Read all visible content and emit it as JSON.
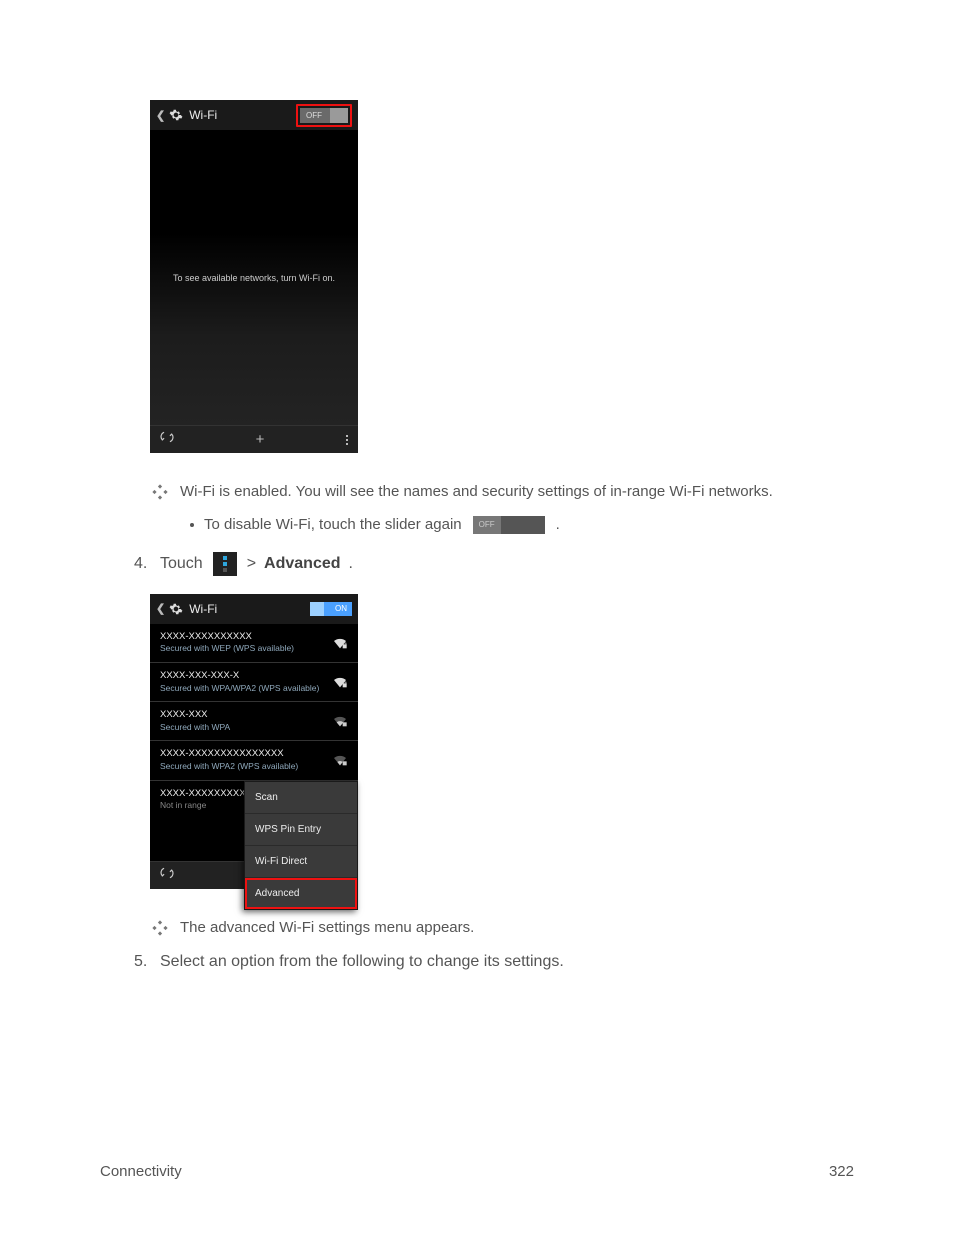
{
  "phone1": {
    "title": "Wi-Fi",
    "toggle": "OFF",
    "message": "To see available networks, turn Wi-Fi on."
  },
  "notes": {
    "enabled": "Wi-Fi is enabled. You will see the names and security settings of in-range Wi-Fi networks.",
    "disable_prefix": "To disable Wi-Fi, touch the slider again",
    "inline_off": "OFF",
    "period": ".",
    "advanced_menu": "The advanced Wi-Fi settings menu appears."
  },
  "steps": {
    "s4": {
      "num": "4.",
      "touch": "Touch",
      "gt": ">",
      "advanced": "Advanced",
      "period": "."
    },
    "s5": {
      "num": "5.",
      "text": "Select an option from the following to change its settings."
    }
  },
  "phone2": {
    "title": "Wi-Fi",
    "toggle": "ON",
    "networks": [
      {
        "ssid": "XXXX-XXXXXXXXXX",
        "sec": "Secured with WEP (WPS available)",
        "signal": "strong"
      },
      {
        "ssid": "XXXX-XXX-XXX-X",
        "sec": "Secured with WPA/WPA2 (WPS available)",
        "signal": "strong"
      },
      {
        "ssid": "XXXX-XXX",
        "sec": "Secured with WPA",
        "signal": "weak"
      },
      {
        "ssid": "XXXX-XXXXXXXXXXXXXXX",
        "sec": "Secured with WPA2 (WPS available)",
        "signal": "weak"
      },
      {
        "ssid": "XXXX-XXXXXXXXX",
        "sec": "Not in range",
        "signal": "none",
        "gray": true
      }
    ],
    "menu": [
      "Scan",
      "WPS Pin Entry",
      "Wi-Fi Direct",
      "Advanced"
    ]
  },
  "footer": {
    "section": "Connectivity",
    "page": "322"
  }
}
